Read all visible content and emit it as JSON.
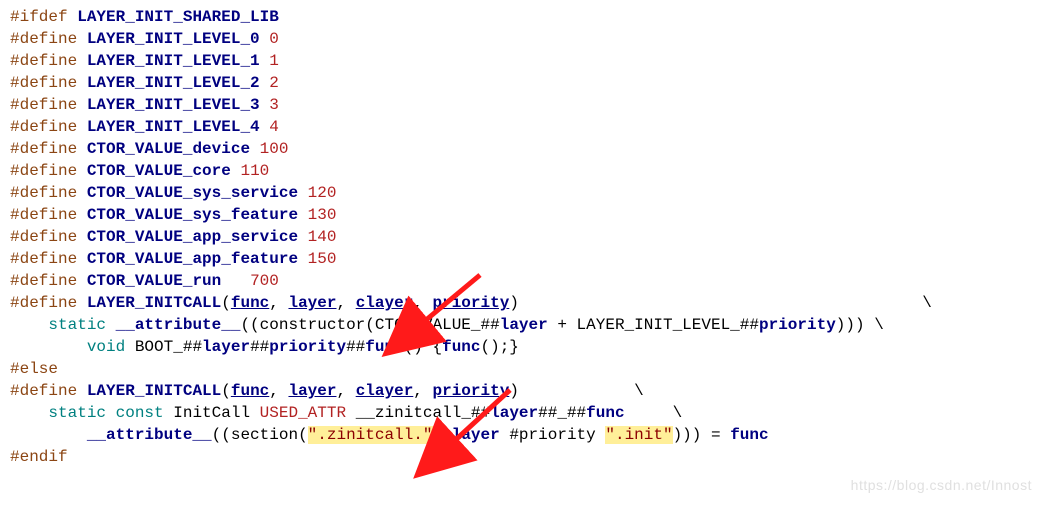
{
  "watermark": "https://blog.csdn.net/Innost",
  "tokens": {
    "l1": {
      "pp": "#ifdef",
      "sp": " ",
      "id": "LAYER_INIT_SHARED_LIB"
    },
    "l2": {
      "pp": "#define",
      "sp": " ",
      "id": "LAYER_INIT_LEVEL_0",
      "sp2": " ",
      "nm": "0"
    },
    "l3": {
      "pp": "#define",
      "sp": " ",
      "id": "LAYER_INIT_LEVEL_1",
      "sp2": " ",
      "nm": "1"
    },
    "l4": {
      "pp": "#define",
      "sp": " ",
      "id": "LAYER_INIT_LEVEL_2",
      "sp2": " ",
      "nm": "2"
    },
    "l5": {
      "pp": "#define",
      "sp": " ",
      "id": "LAYER_INIT_LEVEL_3",
      "sp2": " ",
      "nm": "3"
    },
    "l6": {
      "pp": "#define",
      "sp": " ",
      "id": "LAYER_INIT_LEVEL_4",
      "sp2": " ",
      "nm": "4"
    },
    "l7": {
      "pp": "#define",
      "sp": " ",
      "id": "CTOR_VALUE_device",
      "sp2": " ",
      "nm": "100"
    },
    "l8": {
      "pp": "#define",
      "sp": " ",
      "id": "CTOR_VALUE_core",
      "sp2": " ",
      "nm": "110"
    },
    "l9": {
      "pp": "#define",
      "sp": " ",
      "id": "CTOR_VALUE_sys_service",
      "sp2": " ",
      "nm": "120"
    },
    "l10": {
      "pp": "#define",
      "sp": " ",
      "id": "CTOR_VALUE_sys_feature",
      "sp2": " ",
      "nm": "130"
    },
    "l11": {
      "pp": "#define",
      "sp": " ",
      "id": "CTOR_VALUE_app_service",
      "sp2": " ",
      "nm": "140"
    },
    "l12": {
      "pp": "#define",
      "sp": " ",
      "id": "CTOR_VALUE_app_feature",
      "sp2": " ",
      "nm": "150"
    },
    "l13": {
      "pp": "#define",
      "sp": " ",
      "id": "CTOR_VALUE_run",
      "sp2": "   ",
      "nm": "700"
    },
    "l14": {
      "pp": "#define",
      "sp": " ",
      "id": "LAYER_INITCALL",
      "op": "(",
      "p1": "func",
      "c1": ", ",
      "p2": "layer",
      "c2": ", ",
      "p3": "clayer",
      "c3": ", ",
      "p4": "priority",
      "cl": ")",
      "tail": "                                          ",
      "bs": "\\"
    },
    "l15": {
      "ind": "    ",
      "kw1": "static",
      "sp1": " ",
      "attr": "__attribute__",
      "op": "((",
      "ctor": "constructor",
      "op2": "(",
      "ctv": "CTOR_VALUE_",
      "hh": "##",
      "ly": "layer",
      "plus": " + ",
      "lil": "LAYER_INIT_LEVEL_",
      "hh2": "##",
      "pri": "priority",
      "cl": "))) ",
      "bs": "\\"
    },
    "l16": {
      "ind": "        ",
      "kw": "void",
      "sp": " ",
      "boot": "BOOT_",
      "hh": "##",
      "ly": "layer",
      "hh2": "##",
      "pri": "priority",
      "hh3": "##",
      "fn": "func",
      "paren": "() {",
      "fn2": "func",
      "tail": "();}"
    },
    "l17": {
      "pp": "#else"
    },
    "l18": {
      "pp": "#define",
      "sp": " ",
      "id": "LAYER_INITCALL",
      "op": "(",
      "p1": "func",
      "c1": ", ",
      "p2": "layer",
      "c2": ", ",
      "p3": "clayer",
      "c3": ", ",
      "p4": "priority",
      "cl": ")",
      "tail": "            ",
      "bs": "\\"
    },
    "l19": {
      "ind": "    ",
      "kw1": "static",
      "sp1": " ",
      "kw2": "const",
      "sp2": " ",
      "ic": "InitCall",
      "sp3": " ",
      "ua": "USED_ATTR",
      "sp4": " ",
      "zin": "__zinitcall_",
      "hh": "##",
      "ly": "layer",
      "hh2": "##",
      "us": "_",
      "hh3": "##",
      "fn": "func",
      "tail": "     ",
      "bs": "\\"
    },
    "l20": {
      "ind": "        ",
      "attr": "__attribute__",
      "op": "((",
      "sec": "section",
      "op2": "(",
      "s1": "\".zinitcall.\"",
      "sp1": " ",
      "cl": "clayer",
      "sp2": " ",
      "hp": "#priority",
      "sp3": " ",
      "s2": "\".init\"",
      "close": "))) = ",
      "fn": "func"
    },
    "l21": {
      "pp": "#endif"
    }
  }
}
